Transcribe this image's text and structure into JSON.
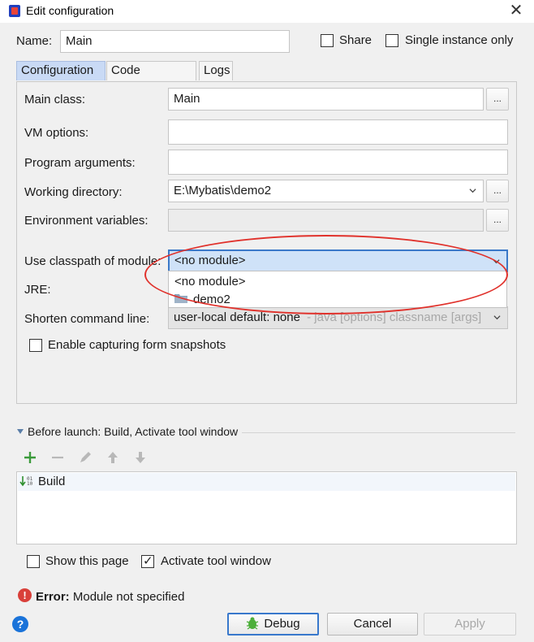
{
  "window": {
    "title": "Edit configuration"
  },
  "header": {
    "name_label": "Name:",
    "name_value": "Main",
    "share_label": "Share",
    "single_instance_label": "Single instance only"
  },
  "tabs": [
    {
      "label": "Configuration",
      "active": true
    },
    {
      "label": "Code Coverage",
      "active": false
    },
    {
      "label": "Logs",
      "active": false
    }
  ],
  "form": {
    "main_class_label": "Main class:",
    "main_class_value": "Main",
    "vm_options_label": "VM options:",
    "vm_options_value": "",
    "program_arguments_label": "Program arguments:",
    "program_arguments_value": "",
    "working_directory_label": "Working directory:",
    "working_directory_value": "E:\\Mybatis\\demo2",
    "env_vars_label": "Environment variables:",
    "env_vars_value": "",
    "classpath_label": "Use classpath of module:",
    "classpath_value": "<no module>",
    "jre_label": "JRE:",
    "shorten_label": "Shorten command line:",
    "shorten_value": "user-local default: none",
    "shorten_hint": "- java [options] classname [args]",
    "capture_label": "Enable capturing form snapshots",
    "ellipsis": "..."
  },
  "classpath_dropdown": {
    "options": [
      "<no module>",
      "demo2"
    ]
  },
  "before_launch": {
    "title": "Before launch: Build, Activate tool window",
    "items": [
      "Build"
    ]
  },
  "footer": {
    "show_page_label": "Show this page",
    "activate_tool_label": "Activate tool window",
    "error_prefix": "Error:",
    "error_message": "Module not specified",
    "help_glyph": "?",
    "debug_label": "Debug",
    "cancel_label": "Cancel",
    "apply_label": "Apply"
  },
  "colors": {
    "active_tab": "#c9daf5",
    "highlight_ellipse": "#e0312b",
    "add_icon": "#3a9a3a",
    "error_icon": "#d9403a",
    "default_button_border": "#3878cc"
  }
}
